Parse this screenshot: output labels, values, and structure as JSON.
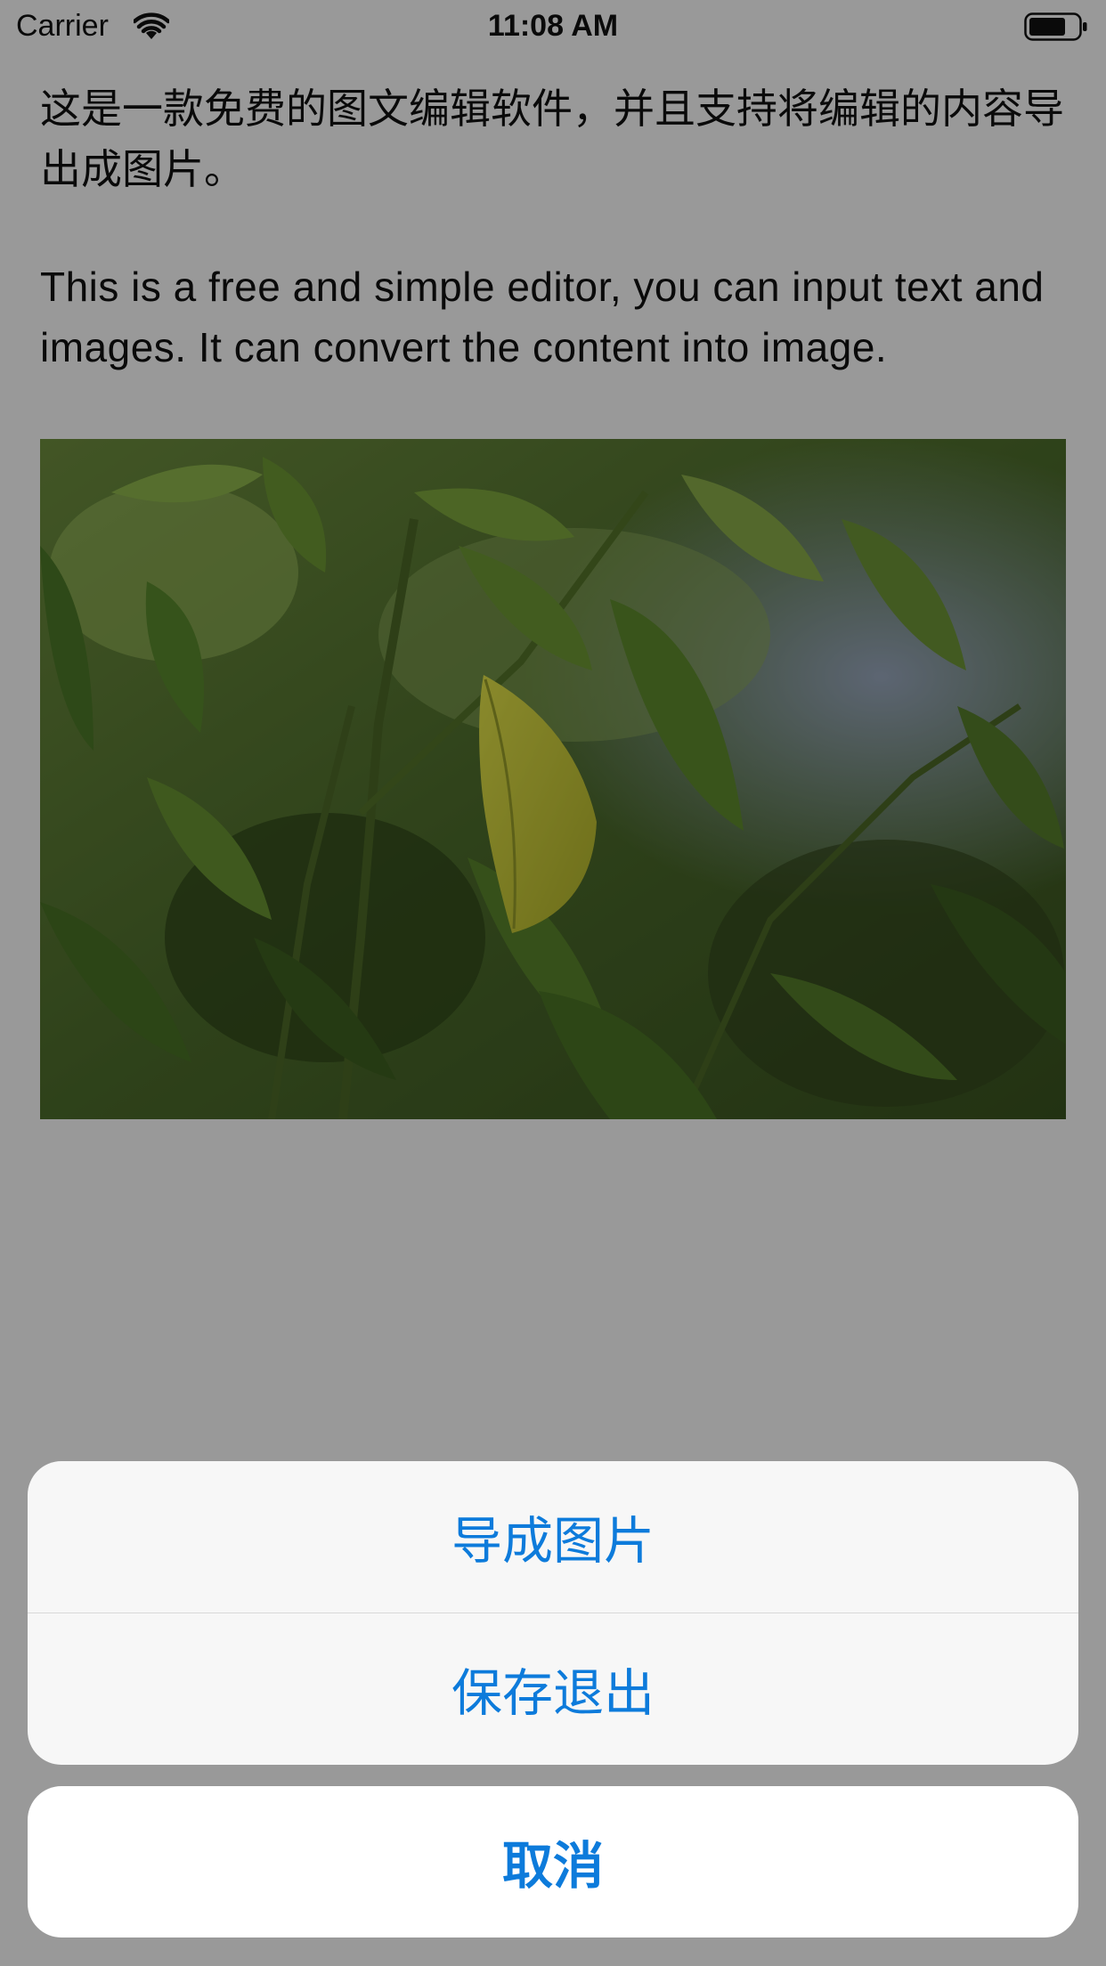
{
  "status_bar": {
    "carrier": "Carrier",
    "time": "11:08 AM",
    "wifi_icon": "wifi-icon",
    "battery_icon": "battery-icon"
  },
  "document": {
    "paragraph_cn": "这是一款免费的图文编辑软件，并且支持将编辑的内容导出成图片。",
    "paragraph_en": "This is a free and simple editor, you can input text and images. It can convert the content into image."
  },
  "action_sheet": {
    "export_image": "导成图片",
    "save_and_exit": "保存退出",
    "cancel": "取消",
    "accent_color": "#0d7bdb"
  }
}
